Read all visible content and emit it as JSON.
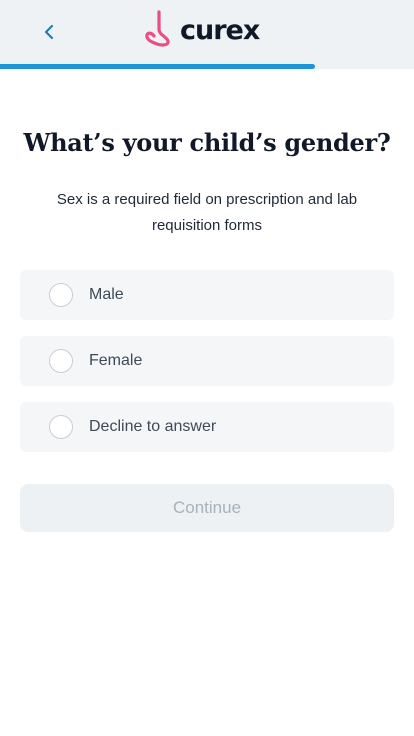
{
  "header": {
    "back_icon": "chevron-left-icon",
    "logo_text": "curex",
    "logo_mark_icon": "curex-logo-mark-icon",
    "progress": 0.76
  },
  "colors": {
    "header_bg": "#eef2f5",
    "progress": "#1e95d8",
    "logo_mark": "#e94e86",
    "back_icon": "#1e7fb0",
    "option_bg": "#f4f6f8",
    "button_disabled_bg": "#edf1f4",
    "button_disabled_text": "#a8b2bc"
  },
  "question": {
    "title": "What’s your child’s gender?",
    "subtitle": "Sex is a required field on prescription and lab requisition forms"
  },
  "options": [
    {
      "label": "Male",
      "selected": false
    },
    {
      "label": "Female",
      "selected": false
    },
    {
      "label": "Decline to answer",
      "selected": false
    }
  ],
  "continue_button": {
    "label": "Continue",
    "disabled": true
  }
}
